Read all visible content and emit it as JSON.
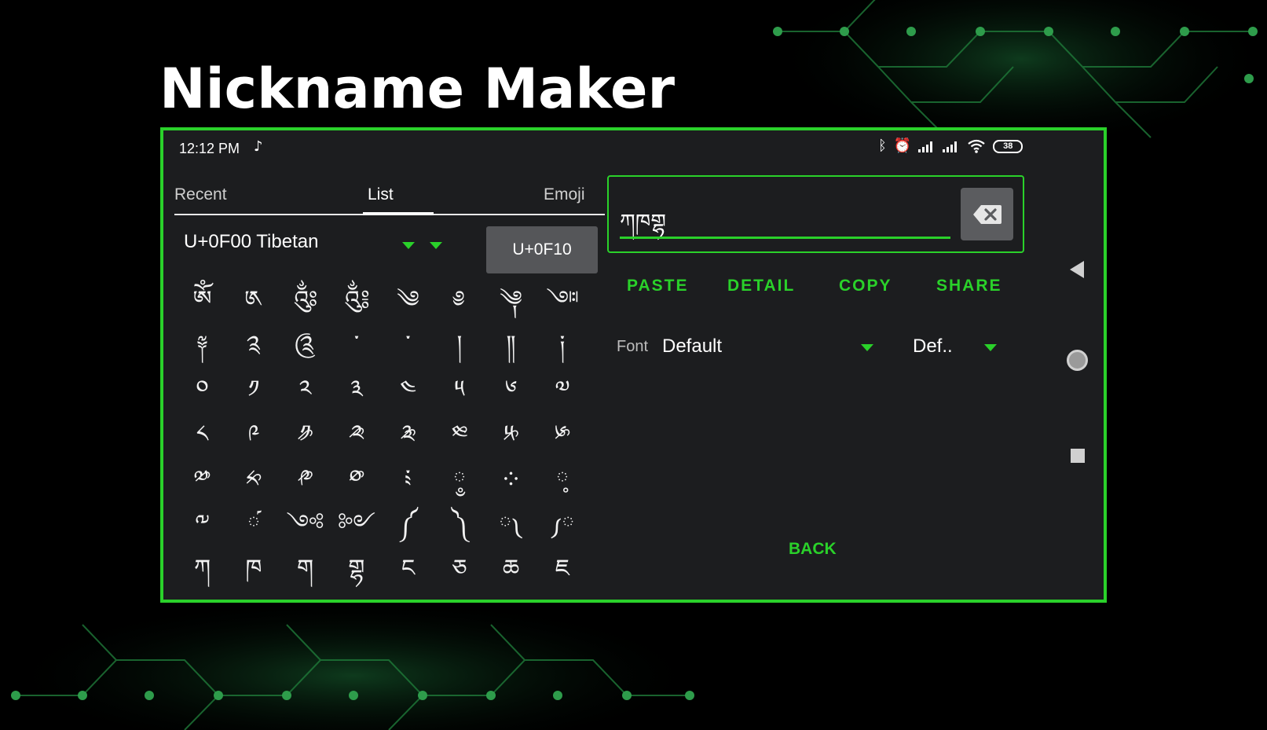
{
  "promo_title": "Nickname Maker",
  "colors": {
    "accent": "#2ad12a",
    "panel_bg": "#1c1d1f",
    "button_bg": "#555659"
  },
  "status_bar": {
    "time": "12:12 PM",
    "music_icon": "music-note-icon",
    "icons": [
      "bluetooth-icon",
      "alarm-icon",
      "signal-icon",
      "signal-icon",
      "wifi-icon"
    ],
    "battery": "38"
  },
  "tabs": [
    {
      "label": "Recent"
    },
    {
      "label": "List",
      "active": true
    },
    {
      "label": "Emoji"
    }
  ],
  "block_selector": {
    "value": "U+0F00 Tibetan"
  },
  "code_button": {
    "label": "U+0F10"
  },
  "glyphs": [
    [
      "ༀ",
      "༁",
      "༂",
      "༃",
      "༄",
      "༅",
      "༆",
      "༇"
    ],
    [
      "༈",
      "༉",
      "༊",
      "་",
      "༌",
      "།",
      "༎",
      "༏"
    ],
    [
      "༠",
      "༡",
      "༢",
      "༣",
      "༤",
      "༥",
      "༦",
      "༧"
    ],
    [
      "༨",
      "༩",
      "༪",
      "༫",
      "༬",
      "༭",
      "༮",
      "༯"
    ],
    [
      "༰",
      "༱",
      "༲",
      "༳",
      "༴",
      "༵",
      "༶",
      "༷"
    ],
    [
      "༸",
      "༹",
      "༺",
      "༻",
      "༼",
      "༽",
      "༾",
      "༿"
    ],
    [
      "ཀ",
      "ཁ",
      "ག",
      "གྷ",
      "ང",
      "ཅ",
      "ཆ",
      "ཇ"
    ]
  ],
  "text_input": {
    "value": "ཀཁགྷ"
  },
  "actions": {
    "paste": "PASTE",
    "detail": "DETAIL",
    "copy": "COPY",
    "share": "SHARE"
  },
  "font": {
    "label": "Font",
    "value": "Default",
    "style_value": "Def.."
  },
  "back_label": "BACK",
  "nav_bar": {
    "back_icon": "nav-back-icon",
    "home_icon": "nav-home-icon",
    "recent_icon": "nav-recent-icon"
  }
}
